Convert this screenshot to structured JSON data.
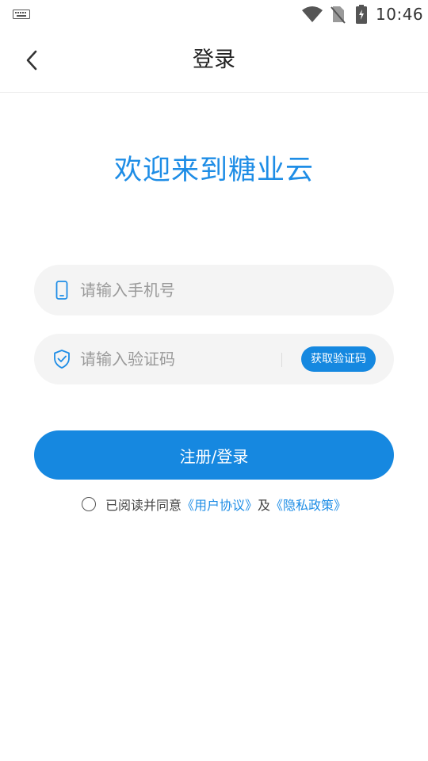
{
  "status_bar": {
    "time": "10:46",
    "icons": [
      "keyboard-icon",
      "wifi-icon",
      "no-sim-icon",
      "battery-charging-icon"
    ]
  },
  "header": {
    "title": "登录",
    "back_icon": "chevron-left-icon"
  },
  "welcome_text": "欢迎来到糖业云",
  "form": {
    "phone": {
      "icon": "phone-icon",
      "value": "",
      "placeholder": "请输入手机号"
    },
    "code": {
      "icon": "shield-check-icon",
      "value": "",
      "placeholder": "请输入验证码",
      "get_code_label": "获取验证码"
    },
    "submit_label": "注册/登录"
  },
  "agreement": {
    "checked": false,
    "prefix": "已阅读并同意",
    "user_agreement": "《用户协议》",
    "conjunction": "及",
    "privacy_policy": "《隐私政策》"
  },
  "colors": {
    "accent": "#1688e0",
    "welcome": "#1e8de6",
    "field_bg": "#f4f4f4"
  }
}
